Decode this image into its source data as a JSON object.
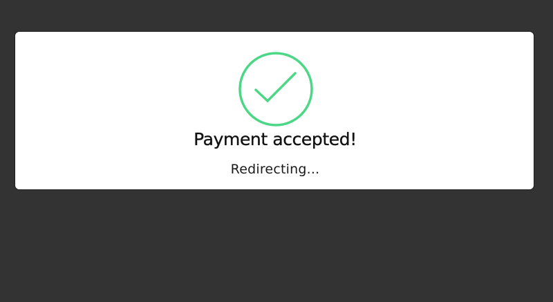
{
  "colors": {
    "background": "#333333",
    "card": "#ffffff",
    "success": "#4cd787",
    "text": "#111111"
  },
  "status": {
    "icon": "check-circle-icon",
    "title": "Payment accepted!",
    "message": "Redirecting..."
  }
}
